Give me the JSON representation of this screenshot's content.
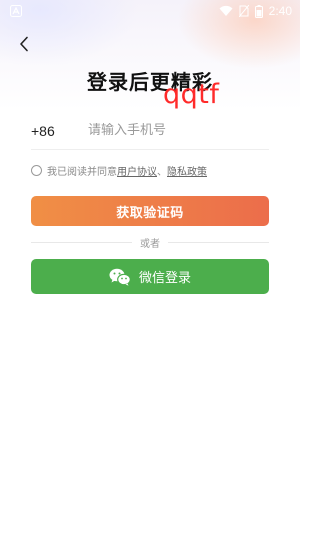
{
  "status_bar": {
    "time": "2:40",
    "icons": [
      "app-notification-icon",
      "wifi-icon",
      "no-sim-icon",
      "battery-icon"
    ]
  },
  "nav": {
    "back_icon": "chevron-left-icon"
  },
  "title": "登录后更精彩",
  "watermark": "qqtf",
  "phone": {
    "country_code": "+86",
    "placeholder": "请输入手机号",
    "value": ""
  },
  "agreement": {
    "prefix": "我已阅读并同意",
    "user_agreement": "用户协议",
    "separator": "、",
    "privacy_policy": "隐私政策",
    "checked": false
  },
  "get_code_button": "获取验证码",
  "divider_text": "或者",
  "wechat_button": {
    "label": "微信登录",
    "icon": "wechat-icon"
  },
  "colors": {
    "primary_gradient_start": "#f08f45",
    "primary_gradient_end": "#ec6d4b",
    "wechat_green": "#4cae4c",
    "watermark_red": "#ff2a2a"
  }
}
